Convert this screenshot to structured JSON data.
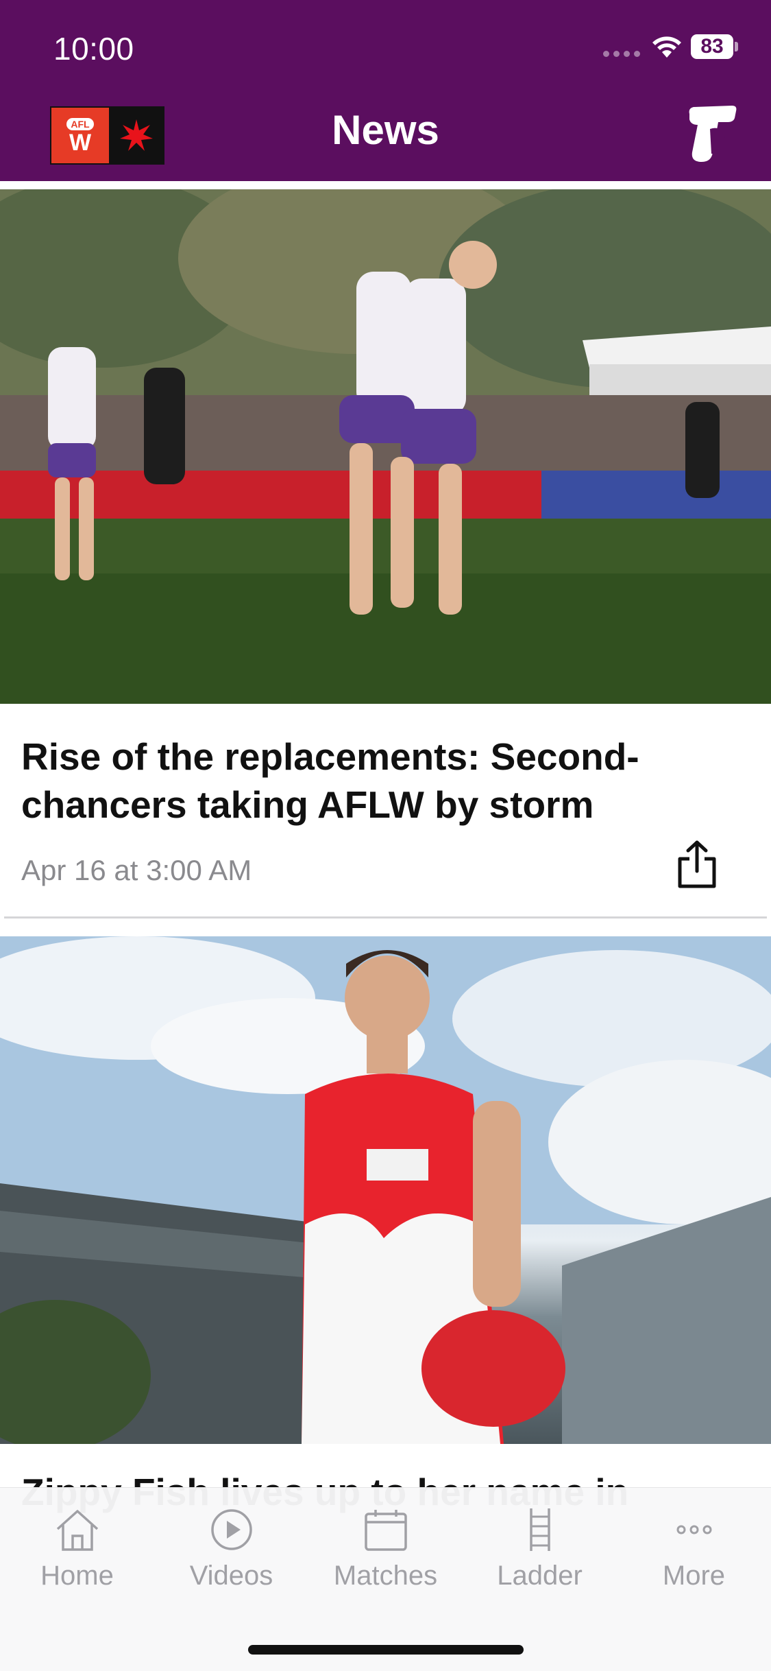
{
  "status_bar": {
    "time": "10:00",
    "battery": "83"
  },
  "header": {
    "title": "News",
    "logo_text": "AFL"
  },
  "articles": [
    {
      "headline": "Rise of the replacements: Second-chancers taking AFLW by storm",
      "timestamp": "Apr 16 at 3:00 AM"
    },
    {
      "headline": "Zippy Fish lives up to her name in"
    }
  ],
  "tabs": [
    {
      "label": "Home",
      "icon": "home-icon"
    },
    {
      "label": "Videos",
      "icon": "play-icon"
    },
    {
      "label": "Matches",
      "icon": "calendar-icon"
    },
    {
      "label": "Ladder",
      "icon": "ladder-icon"
    },
    {
      "label": "More",
      "icon": "more-icon"
    }
  ],
  "colors": {
    "header_bg": "#5b0e5f",
    "tab_inactive": "#a0a0a5",
    "afl_red": "#e63b26"
  }
}
